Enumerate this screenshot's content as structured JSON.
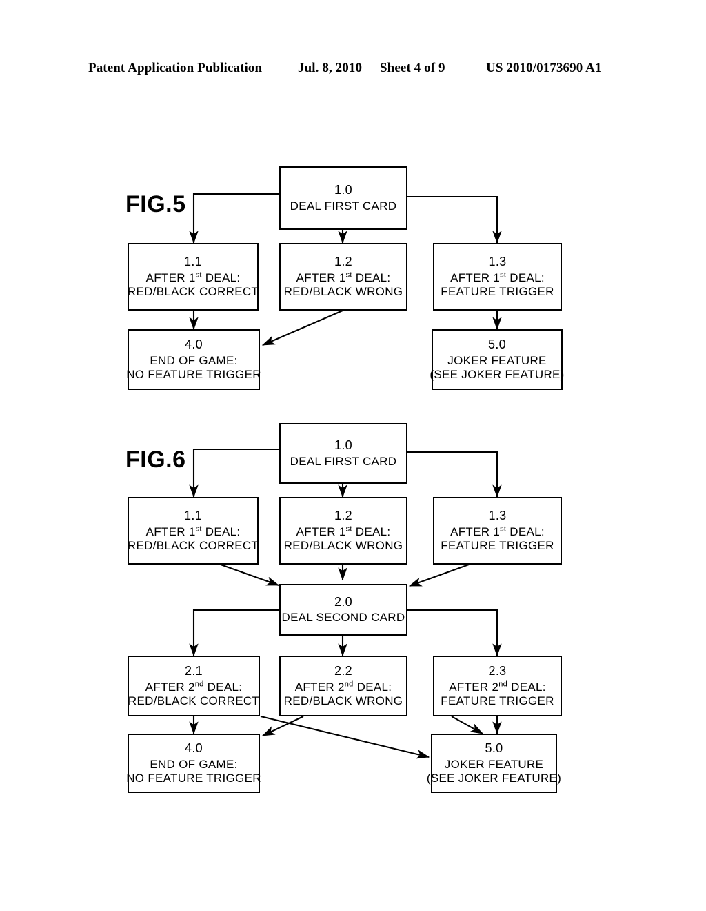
{
  "header": {
    "publication": "Patent Application Publication",
    "date": "Jul. 8, 2010",
    "sheet": "Sheet 4 of 9",
    "doc_number": "US 2010/0173690 A1"
  },
  "figures": [
    {
      "label": "FIG.5",
      "nodes": [
        {
          "id": "1.0",
          "line1": "DEAL FIRST CARD",
          "line2": ""
        },
        {
          "id": "1.1",
          "line1": "AFTER 1st DEAL:",
          "line2": "RED/BLACK CORRECT"
        },
        {
          "id": "1.2",
          "line1": "AFTER 1st DEAL:",
          "line2": "RED/BLACK WRONG"
        },
        {
          "id": "1.3",
          "line1": "AFTER 1st DEAL:",
          "line2": "FEATURE TRIGGER"
        },
        {
          "id": "4.0",
          "line1": "END OF GAME:",
          "line2": "NO FEATURE TRIGGER"
        },
        {
          "id": "5.0",
          "line1": "JOKER FEATURE",
          "line2": "(SEE JOKER FEATURE)"
        }
      ]
    },
    {
      "label": "FIG.6",
      "nodes": [
        {
          "id": "1.0",
          "line1": "DEAL FIRST CARD",
          "line2": ""
        },
        {
          "id": "1.1",
          "line1": "AFTER 1st DEAL:",
          "line2": "RED/BLACK CORRECT"
        },
        {
          "id": "1.2",
          "line1": "AFTER 1st DEAL:",
          "line2": "RED/BLACK WRONG"
        },
        {
          "id": "1.3",
          "line1": "AFTER 1st DEAL:",
          "line2": "FEATURE TRIGGER"
        },
        {
          "id": "2.0",
          "line1": "DEAL SECOND CARD",
          "line2": ""
        },
        {
          "id": "2.1",
          "line1": "AFTER 2nd DEAL:",
          "line2": "RED/BLACK CORRECT"
        },
        {
          "id": "2.2",
          "line1": "AFTER 2nd DEAL:",
          "line2": "RED/BLACK WRONG"
        },
        {
          "id": "2.3",
          "line1": "AFTER 2nd DEAL:",
          "line2": "FEATURE TRIGGER"
        },
        {
          "id": "4.0",
          "line1": "END OF GAME:",
          "line2": "NO FEATURE TRIGGER"
        },
        {
          "id": "5.0",
          "line1": "JOKER FEATURE",
          "line2": "(SEE JOKER FEATURE)"
        }
      ]
    }
  ],
  "ordinals": {
    "first_prefix": "AFTER 1",
    "first_sup": "st",
    "first_suffix": " DEAL:",
    "second_prefix": "AFTER 2",
    "second_sup": "nd",
    "second_suffix": " DEAL:"
  },
  "colors": {
    "ink": "#000000",
    "paper": "#ffffff"
  }
}
